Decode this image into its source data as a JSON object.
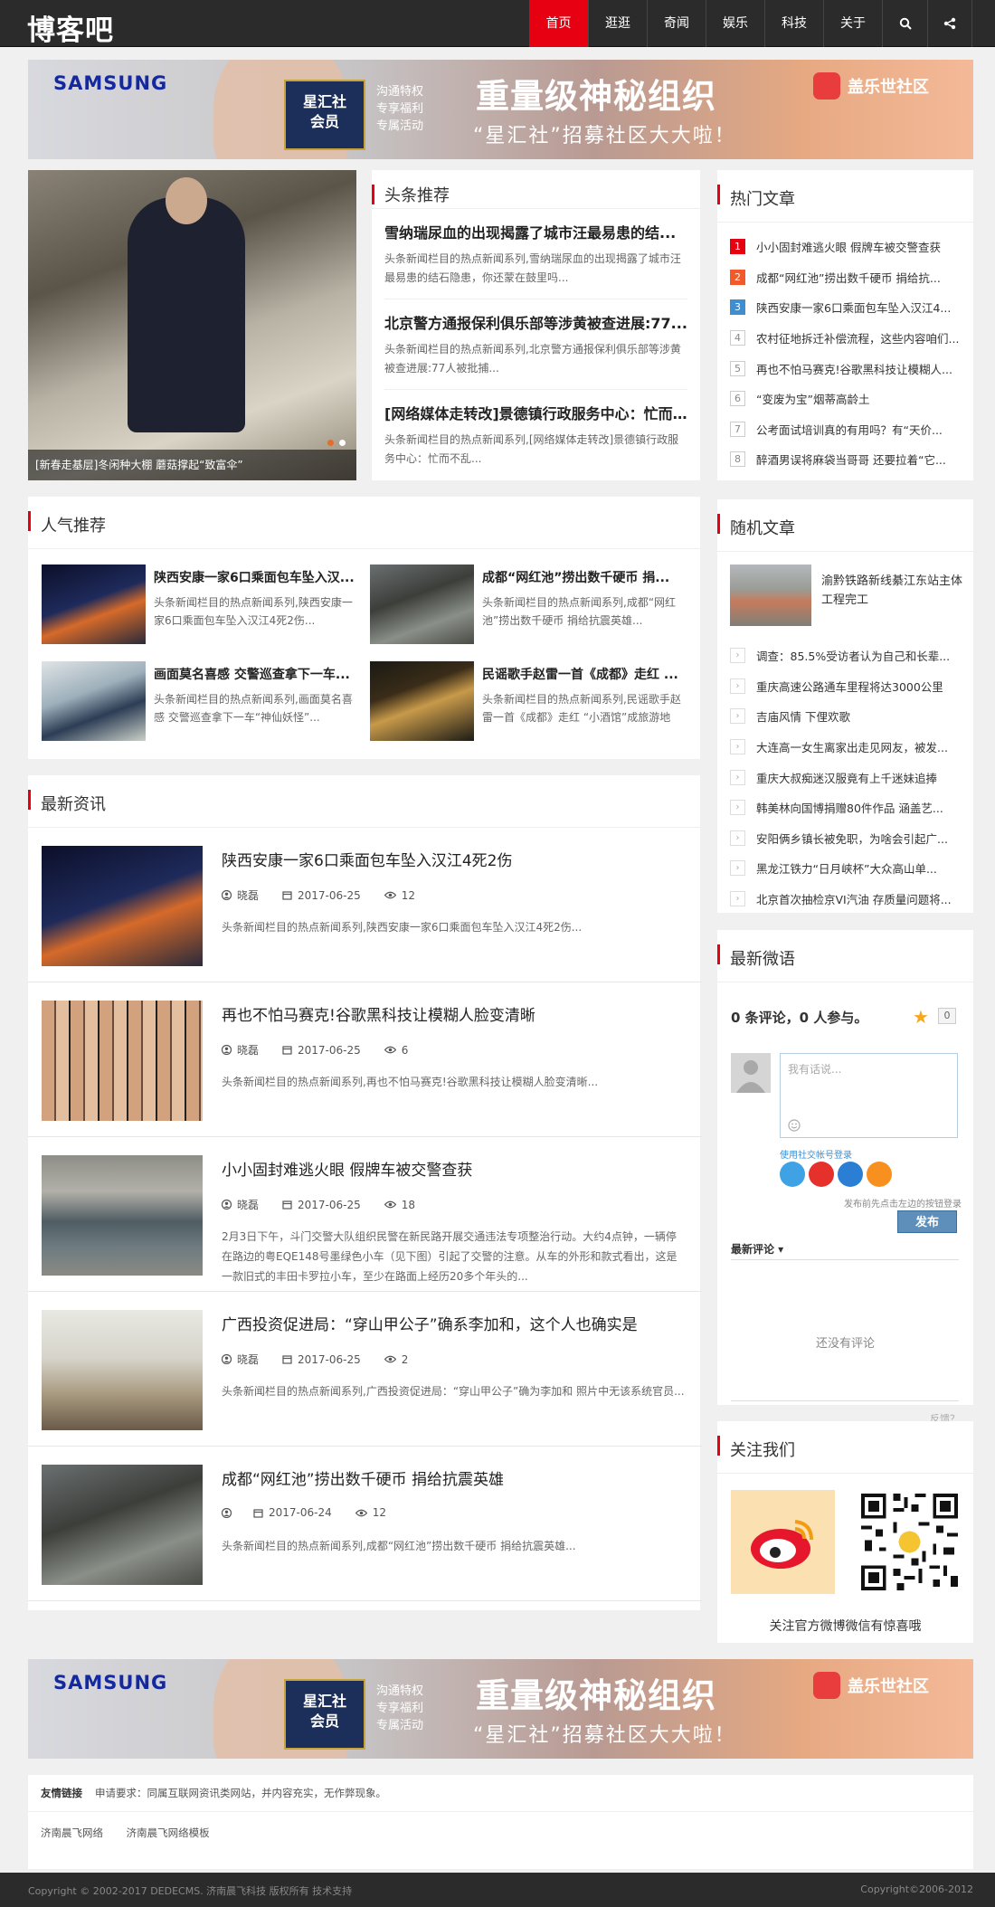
{
  "site": {
    "logo": "博客吧"
  },
  "nav": {
    "items": [
      "首页",
      "逛逛",
      "奇闻",
      "娱乐",
      "科技",
      "关于"
    ],
    "active": 0
  },
  "banner": {
    "brand_left": "SAMSUNG",
    "card": [
      "星汇社",
      "会员"
    ],
    "perks": [
      "沟通特权",
      "专享福利",
      "专属活动"
    ],
    "headline": "重量级神秘组织",
    "subline": "“星汇社”招募社区大大啦！",
    "brand_right": "盖乐世社区"
  },
  "slider": {
    "caption": "[新春走基层]冬闲种大棚 蘑菇撑起“致富伞”"
  },
  "headline": {
    "title": "头条推荐",
    "items": [
      {
        "title": "雪纳瑞尿血的出现揭露了城市汪最易患的结...",
        "desc": "头条新闻栏目的热点新闻系列,雪纳瑞尿血的出现揭露了城市汪最易患的结石隐患，你还蒙在鼓里吗..."
      },
      {
        "title": "北京警方通报保利俱乐部等涉黄被查进展:77...",
        "desc": "头条新闻栏目的热点新闻系列,北京警方通报保利俱乐部等涉黄被查进展:77人被批捕..."
      },
      {
        "title": "[网络媒体走转改]景德镇行政服务中心：忙而...",
        "desc": "头条新闻栏目的热点新闻系列,[网络媒体走转改]景德镇行政服务中心：忙而不乱..."
      }
    ]
  },
  "hot": {
    "title": "热门文章",
    "items": [
      "小小固封难逃火眼 假牌车被交警查获",
      "成都“网红池”捞出数千硬币 捐给抗...",
      "陕西安康一家6口乘面包车坠入汉江4...",
      "农村征地拆迁补偿流程，这些内容咱们...",
      "再也不怕马赛克!谷歌黑科技让模糊人...",
      "“变废为宝”烟蒂高龄土",
      "公考面试培训真的有用吗？有“天价...",
      "醉酒男误将麻袋当哥哥 还要拉着“它..."
    ]
  },
  "popular": {
    "title": "人气推荐",
    "items": [
      {
        "title": "陕西安康一家6口乘面包车坠入汉...",
        "desc": "头条新闻栏目的热点新闻系列,陕西安康一家6口乘面包车坠入汉江4死2伤..."
      },
      {
        "title": "成都“网红池”捞出数千硬币 捐...",
        "desc": "头条新闻栏目的热点新闻系列,成都“网红池”捞出数千硬币 捐给抗震英雄..."
      },
      {
        "title": "画面莫名喜感 交警巡查拿下一车...",
        "desc": "头条新闻栏目的热点新闻系列,画面莫名喜感 交警巡查拿下一车“神仙妖怪”..."
      },
      {
        "title": "民谣歌手赵雷一首《成都》走红 ...",
        "desc": "头条新闻栏目的热点新闻系列,民谣歌手赵雷一首《成都》走红 “小酒馆”成旅游地标..."
      }
    ]
  },
  "latest": {
    "title": "最新资讯",
    "items": [
      {
        "title": "陕西安康一家6口乘面包车坠入汉江4死2伤",
        "author": "晓磊",
        "date": "2017-06-25",
        "views": "12",
        "desc": "头条新闻栏目的热点新闻系列,陕西安康一家6口乘面包车坠入汉江4死2伤..."
      },
      {
        "title": "再也不怕马赛克!谷歌黑科技让模糊人脸变清晰",
        "author": "晓磊",
        "date": "2017-06-25",
        "views": "6",
        "desc": "头条新闻栏目的热点新闻系列,再也不怕马赛克!谷歌黑科技让模糊人脸变清晰..."
      },
      {
        "title": "小小固封难逃火眼 假牌车被交警查获",
        "author": "晓磊",
        "date": "2017-06-25",
        "views": "18",
        "desc": "2月3日下午，斗门交警大队组织民警在新民路开展交通违法专项整治行动。大约4点钟，一辆停在路边的粤EQE148号墨绿色小车（见下图）引起了交警的注意。从车的外形和款式看出，这是一款旧式的丰田卡罗拉小车，至少在路面上经历20多个年头的..."
      },
      {
        "title": "广西投资促进局：“穿山甲公子”确系李加和，这个人也确实是",
        "author": "晓磊",
        "date": "2017-06-25",
        "views": "2",
        "desc": "头条新闻栏目的热点新闻系列,广西投资促进局：“穿山甲公子”确为李加和 照片中无该系统官员..."
      },
      {
        "title": "成都“网红池”捞出数千硬币 捐给抗震英雄",
        "author": "",
        "date": "2017-06-24",
        "views": "12",
        "desc": "头条新闻栏目的热点新闻系列,成都“网红池”捞出数千硬币 捐给抗震英雄..."
      }
    ]
  },
  "random": {
    "title": "随机文章",
    "top": "渝黔铁路新线綦江东站主体工程完工",
    "items": [
      "调查：85.5%受访者认为自己和长辈...",
      "重庆高速公路通车里程将达3000公里",
      "吉庙风情 下俚欢歌",
      "大连高一女生离家出走见网友，被发...",
      "重庆大叔痴迷汉服竟有上千迷妹追捧",
      "韩美林向国博捐赠80件作品 涵盖艺...",
      "安阳俩乡镇长被免职，为啥会引起广...",
      "黑龙江铁力“日月峡杯”大众高山单...",
      "北京首次抽检京VI汽油 存质量问题将..."
    ]
  },
  "comments": {
    "title": "最新微语",
    "count": "0 条评论，0 人参与。",
    "zero": "0",
    "placeholder": "我有话说...",
    "login_label": "使用社交帐号登录",
    "hint": "发布前先点击左边的按钮登录",
    "publish": "发布",
    "latest": "最新评论 ▾",
    "none": "还没有评论",
    "feedback": "反馈？"
  },
  "follow": {
    "title": "关注我们",
    "label": "关注官方微博微信有惊喜哦"
  },
  "friends": {
    "label": "友情链接",
    "request": "申请要求：同属互联网资讯类网站，并内容充实，无作弊现象。",
    "links": [
      "济南晨飞网络",
      "济南晨飞网络模板"
    ]
  },
  "footer": {
    "left": "Copyright © 2002-2017 DEDECMS. 济南晨飞科技 版权所有 技术支持",
    "right": "Copyright©2006-2012"
  },
  "colors": {
    "accent": "#e60012",
    "header": "#2b2b2b"
  }
}
